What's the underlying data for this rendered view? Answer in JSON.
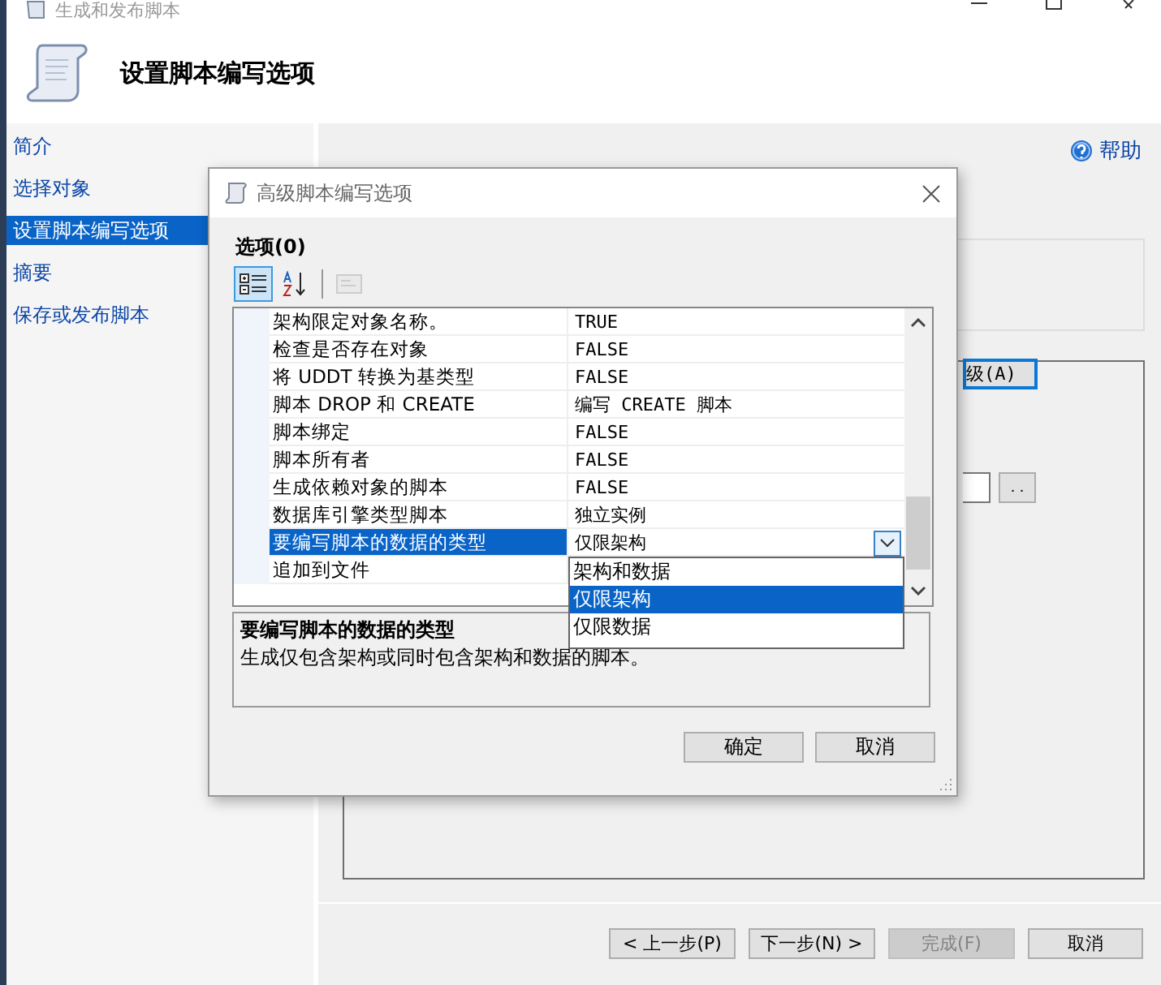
{
  "window": {
    "title": "生成和发布脚本"
  },
  "header": {
    "title": "设置脚本编写选项"
  },
  "help_link": "帮助",
  "sidebar": {
    "items": [
      {
        "label": "简介",
        "selected": false
      },
      {
        "label": "选择对象",
        "selected": false
      },
      {
        "label": "设置脚本编写选项",
        "selected": true
      },
      {
        "label": "摘要",
        "selected": false
      },
      {
        "label": "保存或发布脚本",
        "selected": false
      }
    ]
  },
  "background": {
    "advanced_button": "级(A)",
    "browse_button": ". ."
  },
  "dialog": {
    "title": "高级脚本编写选项",
    "section_label": "选项(0)",
    "toolbar": [
      {
        "kind": "categorized",
        "selected": true,
        "disabled": false
      },
      {
        "kind": "alphabetical",
        "selected": false,
        "disabled": false
      },
      {
        "kind": "property-pages",
        "selected": false,
        "disabled": true
      }
    ],
    "properties": [
      {
        "name": "架构限定对象名称。",
        "value": "TRUE",
        "selected": false
      },
      {
        "name": "检查是否存在对象",
        "value": "FALSE",
        "selected": false
      },
      {
        "name": "将 UDDT 转换为基类型",
        "value": "FALSE",
        "selected": false
      },
      {
        "name": "脚本 DROP 和 CREATE",
        "value": "编写 CREATE 脚本",
        "selected": false
      },
      {
        "name": "脚本绑定",
        "value": "FALSE",
        "selected": false
      },
      {
        "name": "脚本所有者",
        "value": "FALSE",
        "selected": false
      },
      {
        "name": "生成依赖对象的脚本",
        "value": "FALSE",
        "selected": false
      },
      {
        "name": "数据库引擎类型脚本",
        "value": "独立实例",
        "selected": false
      },
      {
        "name": "要编写脚本的数据的类型",
        "value": "仅限架构",
        "selected": true
      },
      {
        "name": "追加到文件",
        "selected": false
      }
    ],
    "dropdown": {
      "options": [
        {
          "label": "架构和数据",
          "selected": false
        },
        {
          "label": "仅限架构",
          "selected": true
        },
        {
          "label": "仅限数据",
          "selected": false
        }
      ]
    },
    "description": {
      "title": "要编写脚本的数据的类型",
      "text": "生成仅包含架构或同时包含架构和数据的脚本。"
    },
    "buttons": [
      "确定",
      "取消"
    ]
  },
  "footer_buttons": [
    {
      "label": "< 上一步(P)",
      "disabled": false
    },
    {
      "label": "下一步(N) >",
      "disabled": false
    },
    {
      "label": "完成(F)",
      "disabled": true
    },
    {
      "label": "取消",
      "disabled": false
    }
  ]
}
